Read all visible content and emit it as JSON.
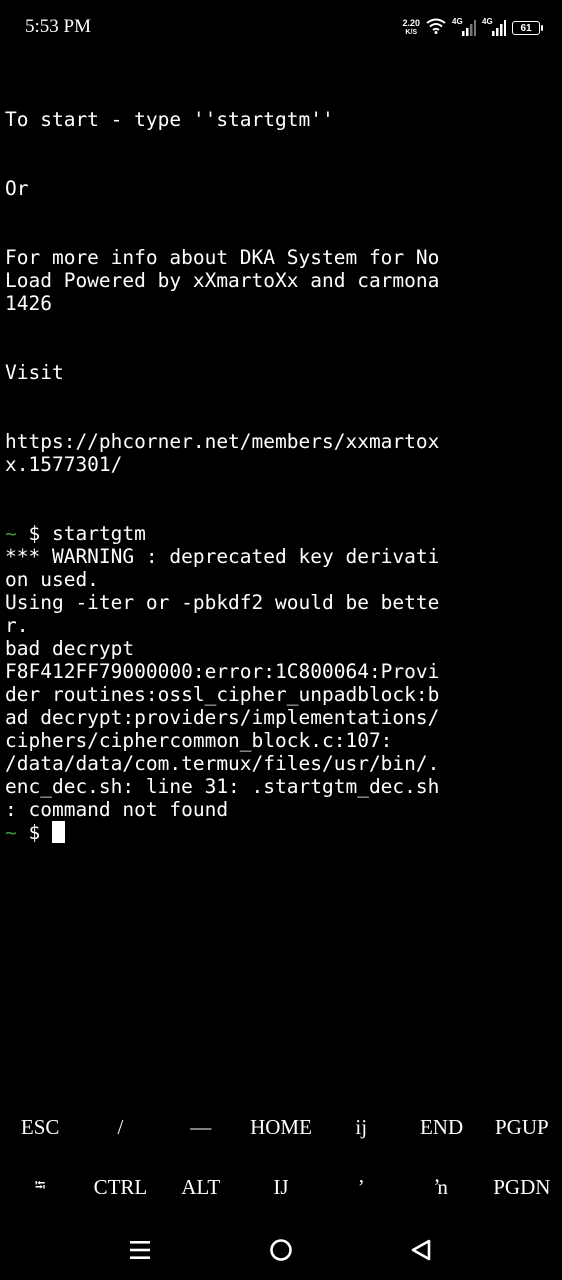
{
  "status_bar": {
    "time": "5:53 PM",
    "net_speed_value": "2.20",
    "net_speed_unit": "K/S",
    "sim1_label": "4G",
    "sim2_label": "4G",
    "battery_level": "61",
    "icons": [
      "wifi-icon",
      "signal-icon",
      "signal-icon",
      "battery-icon"
    ]
  },
  "terminal": {
    "lines": [
      "To start - type ''startgtm''",
      "",
      "",
      "Or",
      "",
      "",
      "For more info about DKA System for No",
      "Load Powered by xXmartoXx and carmona",
      "1426",
      "",
      "",
      "Visit",
      "",
      "",
      "https://phcorner.net/members/xxmartox",
      "x.1577301/",
      "",
      "",
      "@@PROMPT@@startgtm",
      "*** WARNING : deprecated key derivati",
      "on used.",
      "Using -iter or -pbkdf2 would be bette",
      "r.",
      "bad decrypt",
      "F8F412FF79000000:error:1C800064:Provi",
      "der routines:ossl_cipher_unpadblock:b",
      "ad decrypt:providers/implementations/",
      "ciphers/ciphercommon_block.c:107:",
      "/data/data/com.termux/files/usr/bin/.",
      "enc_dec.sh: line 31: .startgtm_dec.sh",
      ": command not found",
      "@@PROMPT_CURSOR@@"
    ],
    "prompt_tilde": "~",
    "prompt_symbol": "$",
    "tilde_color": "#3a9a3a",
    "background": "#000000",
    "foreground": "#ffffff"
  },
  "extra_keys": {
    "row1": [
      {
        "name": "esc-key",
        "label": "ESC"
      },
      {
        "name": "slash-key",
        "label": "/"
      },
      {
        "name": "dash-key",
        "label": "—"
      },
      {
        "name": "home-key",
        "label": "HOME"
      },
      {
        "name": "ij-key",
        "label": "ij"
      },
      {
        "name": "end-key",
        "label": "END"
      },
      {
        "name": "pgup-key",
        "label": "PGUP"
      }
    ],
    "row2": [
      {
        "name": "tab-key",
        "label": "⭾",
        "icon": "tab-icon"
      },
      {
        "name": "ctrl-key",
        "label": "CTRL"
      },
      {
        "name": "alt-key",
        "label": "ALT"
      },
      {
        "name": "IJ-key",
        "label": "IJ"
      },
      {
        "name": "apostrophe-key",
        "label": "ʼ"
      },
      {
        "name": "n-apostrophe-key",
        "label": "ŉ"
      },
      {
        "name": "pgdn-key",
        "label": "PGDN"
      }
    ]
  },
  "nav_bar": {
    "icons": [
      "menu-icon",
      "home-circle-icon",
      "back-triangle-icon"
    ]
  }
}
